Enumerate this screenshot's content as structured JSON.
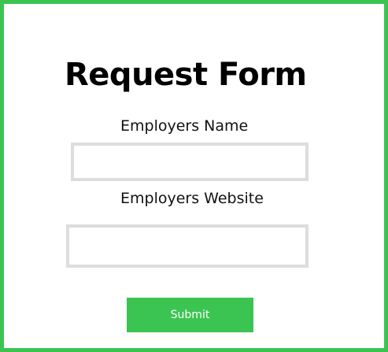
{
  "form": {
    "title": "Request Form",
    "fields": [
      {
        "label": "Employers Name",
        "value": "",
        "placeholder": ""
      },
      {
        "label": "Employers Website",
        "value": "",
        "placeholder": ""
      }
    ],
    "submit_label": "Submit"
  },
  "colors": {
    "accent": "#3cc452",
    "input_border": "#dddddd",
    "background": "#ffffff",
    "text": "#000000"
  }
}
